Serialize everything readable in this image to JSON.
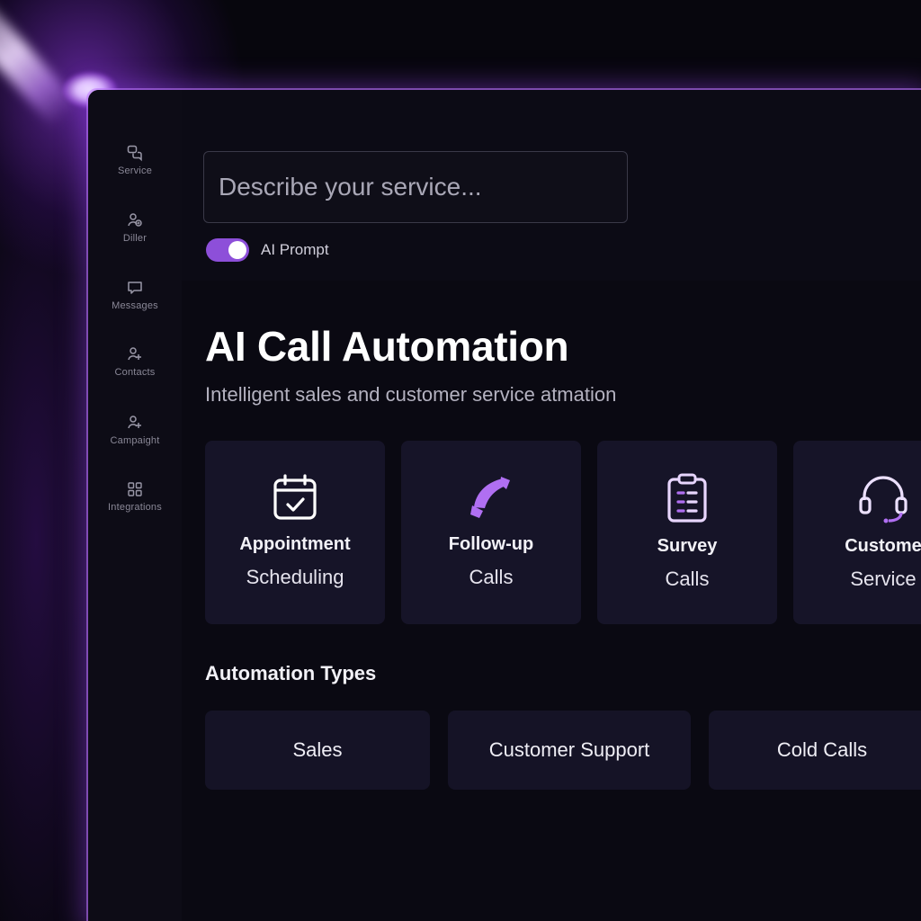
{
  "sidebar": {
    "items": [
      {
        "label": "Service",
        "icon": "chat-bubbles-icon"
      },
      {
        "label": "Diller",
        "icon": "users-add-icon"
      },
      {
        "label": "Messages",
        "icon": "message-icon"
      },
      {
        "label": "Contacts",
        "icon": "contacts-icon"
      },
      {
        "label": "Campaight",
        "icon": "campaign-icon"
      },
      {
        "label": "Integrations",
        "icon": "grid-icon"
      }
    ]
  },
  "search": {
    "placeholder": "Describe your service..."
  },
  "ai_prompt": {
    "label": "AI Prompt",
    "enabled": true
  },
  "hero": {
    "title": "AI Call Automation",
    "subtitle": "Intelligent sales and customer service atmation"
  },
  "cards": [
    {
      "title": "Appointment",
      "subtitle": "Scheduling",
      "icon": "calendar-check-icon"
    },
    {
      "title": "Follow-up",
      "subtitle": "Calls",
      "icon": "phone-icon"
    },
    {
      "title": "Survey",
      "subtitle": "Calls",
      "icon": "clipboard-icon"
    },
    {
      "title": "Custome",
      "subtitle": "Service",
      "icon": "headset-icon"
    }
  ],
  "automation_types": {
    "title": "Automation Types",
    "items": [
      "Sales",
      "Customer Support",
      "Cold Calls"
    ]
  },
  "colors": {
    "accent": "#8d4fd9",
    "background": "#0a0912",
    "card": "#161428",
    "glow": "#b064ff"
  }
}
